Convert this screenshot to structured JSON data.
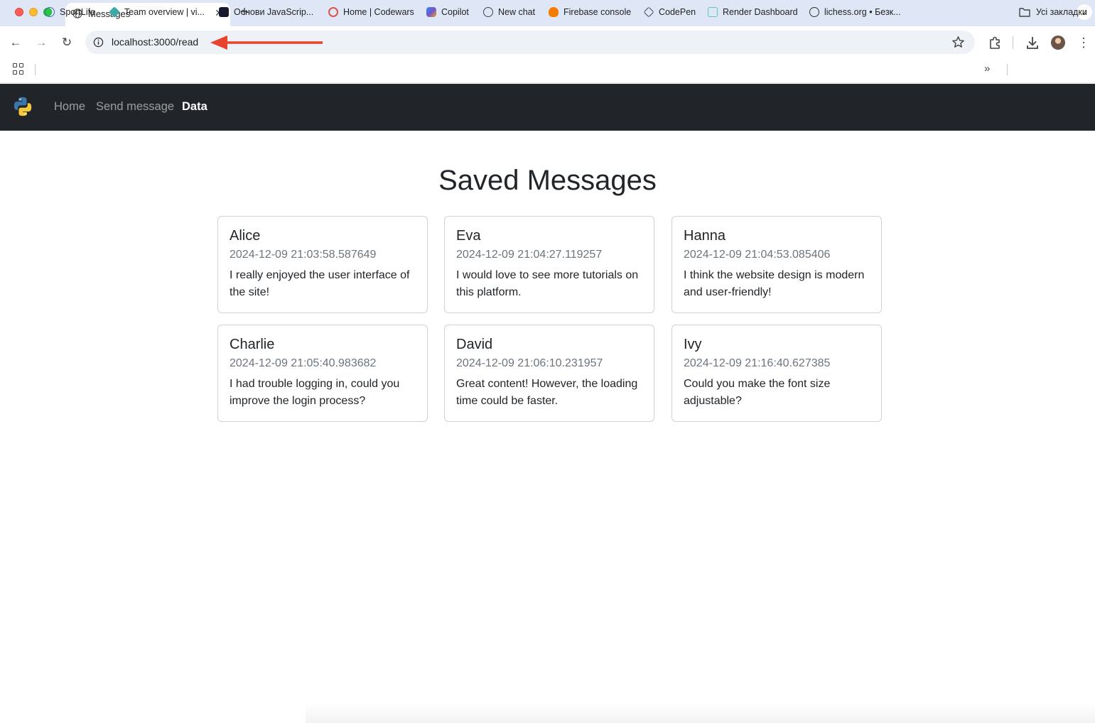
{
  "browser": {
    "tab_title": "Messages",
    "url": "localhost:3000/read",
    "bookmarks": [
      {
        "label": "SportLife",
        "color": "#3b6db3"
      },
      {
        "label": "Team overview | vi...",
        "color": "#3fa9a6"
      },
      {
        "label": "Основи JavaScrip...",
        "color": "#1a1a2e"
      },
      {
        "label": "Home | Codewars",
        "color": "#d9534f"
      },
      {
        "label": "Copilot",
        "color": "#6e56cf"
      },
      {
        "label": "New chat",
        "color": "#444444"
      },
      {
        "label": "Firebase console",
        "color": "#f57c00"
      },
      {
        "label": "CodePen",
        "color": "#222222"
      },
      {
        "label": "Render Dashboard",
        "color": "#5ec8b8"
      },
      {
        "label": "lichess.org • Безк...",
        "color": "#333333"
      }
    ],
    "all_bookmarks_label": "Усі закладки"
  },
  "navbar": {
    "links": [
      {
        "label": "Home",
        "active": false
      },
      {
        "label": "Send message",
        "active": false
      },
      {
        "label": "Data",
        "active": true
      }
    ]
  },
  "main": {
    "title": "Saved Messages",
    "messages": [
      {
        "name": "Alice",
        "timestamp": "2024-12-09 21:03:58.587649",
        "text": "I really enjoyed the user interface of the site!"
      },
      {
        "name": "Eva",
        "timestamp": "2024-12-09 21:04:27.119257",
        "text": "I would love to see more tutorials on this platform."
      },
      {
        "name": "Hanna",
        "timestamp": "2024-12-09 21:04:53.085406",
        "text": "I think the website design is modern and user-friendly!"
      },
      {
        "name": "Charlie",
        "timestamp": "2024-12-09 21:05:40.983682",
        "text": "I had trouble logging in, could you improve the login process?"
      },
      {
        "name": "David",
        "timestamp": "2024-12-09 21:06:10.231957",
        "text": "Great content! However, the loading time could be faster."
      },
      {
        "name": "Ivy",
        "timestamp": "2024-12-09 21:16:40.627385",
        "text": "Could you make the font size adjustable?"
      }
    ]
  },
  "colors": {
    "navbar_bg": "#212529",
    "annotation_arrow": "#e8432d",
    "muted_text": "#6c757d"
  }
}
